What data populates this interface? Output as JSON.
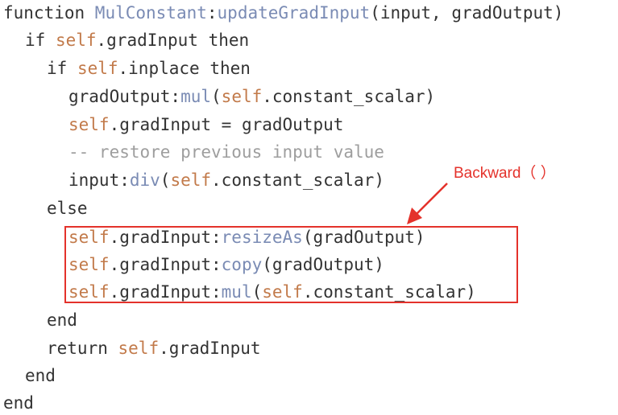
{
  "colors": {
    "keyword": "#333333",
    "self": "#c27a4a",
    "method": "#7a8bb4",
    "comment": "#9e9e9e",
    "annotation": "#e4322b"
  },
  "code": {
    "line1": {
      "kw": "function ",
      "cls": "MulConstant",
      "colon": ":",
      "method": "updateGradInput",
      "args": "(input, gradOutput)"
    },
    "line2": {
      "kw": "if ",
      "self": "self",
      "rest": ".gradInput ",
      "kw2": "then"
    },
    "line3": {
      "kw": "if ",
      "self": "self",
      "rest": ".inplace ",
      "kw2": "then"
    },
    "line4": {
      "obj": "gradOutput:",
      "method": "mul",
      "open": "(",
      "self": "self",
      "rest": ".constant_scalar)"
    },
    "line5": {
      "self": "self",
      "rest": ".gradInput = gradOutput"
    },
    "line6": {
      "comment": "-- restore previous input value"
    },
    "line7": {
      "obj": "input:",
      "method": "div",
      "open": "(",
      "self": "self",
      "rest": ".constant_scalar)"
    },
    "line8": {
      "kw": "else"
    },
    "line9": {
      "self": "self",
      "obj": ".gradInput:",
      "method": "resizeAs",
      "rest": "(gradOutput)"
    },
    "line10": {
      "self": "self",
      "obj": ".gradInput:",
      "method": "copy",
      "rest": "(gradOutput)"
    },
    "line11": {
      "self": "self",
      "obj": ".gradInput:",
      "method": "mul",
      "open": "(",
      "self2": "self",
      "rest": ".constant_scalar)"
    },
    "line12": {
      "kw": "end"
    },
    "line13": {
      "kw": "return ",
      "self": "self",
      "rest": ".gradInput"
    },
    "line14": {
      "kw": "end"
    },
    "line15": {
      "kw": "end"
    }
  },
  "annotation": {
    "label": "Backward（ ）"
  }
}
